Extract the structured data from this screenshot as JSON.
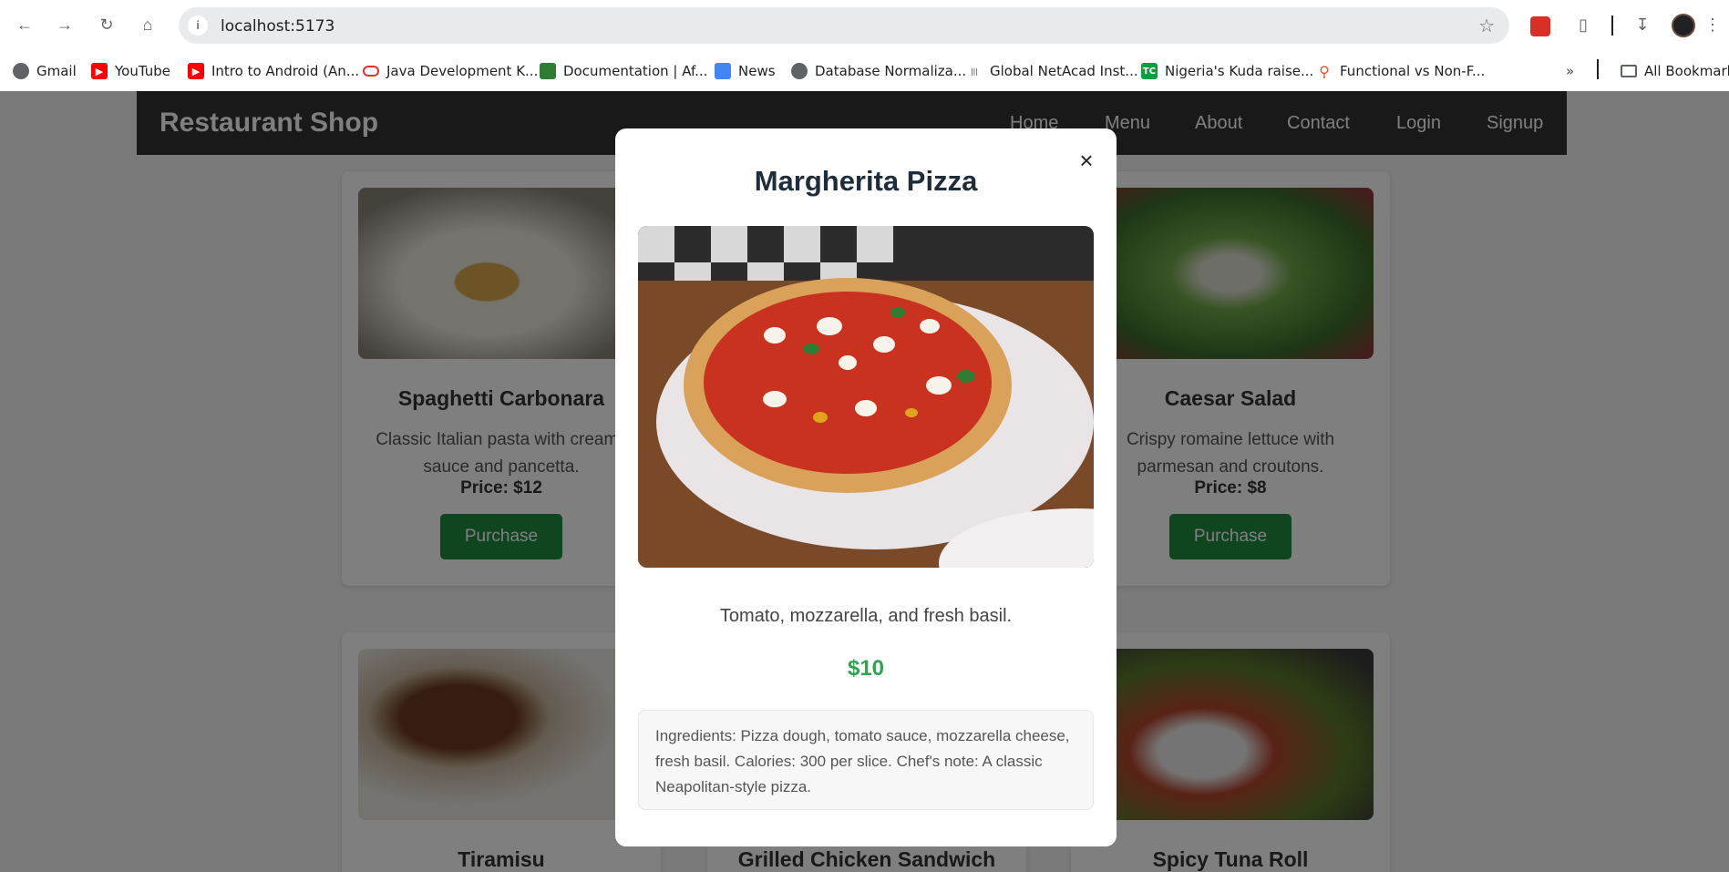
{
  "browser": {
    "url": "localhost:5173",
    "bookmarks": [
      {
        "label": "Gmail"
      },
      {
        "label": "YouTube"
      },
      {
        "label": "Intro to Android (An..."
      },
      {
        "label": "Java Development K..."
      },
      {
        "label": "Documentation | Af..."
      },
      {
        "label": "News"
      },
      {
        "label": "Database Normaliza..."
      },
      {
        "label": "Global NetAcad Inst..."
      },
      {
        "label": "Nigeria's Kuda raise..."
      },
      {
        "label": "Functional vs Non-F..."
      }
    ],
    "all_bookmarks": "All Bookmarks"
  },
  "site": {
    "brand": "Restaurant Shop",
    "nav": [
      "Home",
      "Menu",
      "About",
      "Contact",
      "Login",
      "Signup"
    ]
  },
  "cards": [
    {
      "title": "Spaghetti Carbonara",
      "desc": "Classic Italian pasta with creamy sauce and pancetta.",
      "price": "Price: $12",
      "button": "Purchase"
    },
    {
      "title": "Caesar Salad",
      "desc": "Crispy romaine lettuce with parmesan and croutons.",
      "price": "Price: $8",
      "button": "Purchase"
    },
    {
      "title": "Tiramisu"
    },
    {
      "title": "Grilled Chicken Sandwich"
    },
    {
      "title": "Spicy Tuna Roll"
    }
  ],
  "modal": {
    "title": "Margherita Pizza",
    "close": "×",
    "description": "Tomato, mozzarella, and fresh basil.",
    "price": "$10",
    "details": "Ingredients: Pizza dough, tomato sauce, mozzarella cheese, fresh basil. Calories: 300 per slice. Chef's note: A classic Neapolitan-style pizza."
  },
  "colors": {
    "header_bg": "#333333",
    "button_green": "#1f8a3f",
    "modal_price": "#2ea44f"
  }
}
